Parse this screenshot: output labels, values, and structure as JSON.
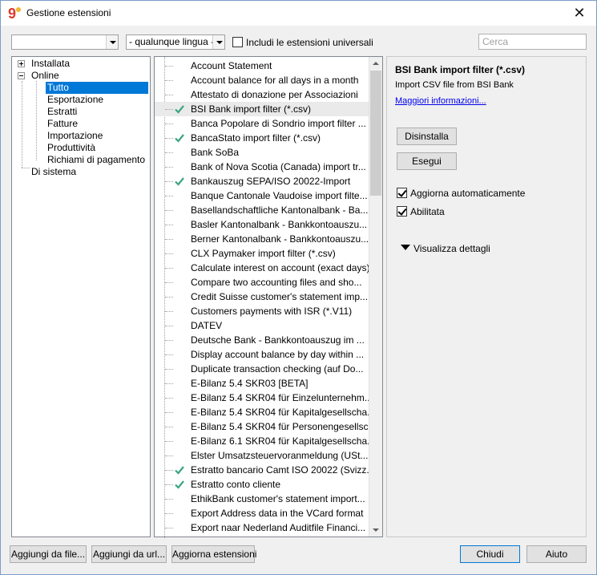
{
  "window": {
    "title": "Gestione estensioni",
    "close_symbol": "✕"
  },
  "toolbar": {
    "category_combo_value": "",
    "language_combo_value": "- qualunque lingua -",
    "universal_checkbox_label": "Includi le estensioni universali",
    "universal_checked": false,
    "search_placeholder": "Cerca"
  },
  "tree": {
    "items": [
      {
        "label": "Installata"
      },
      {
        "label": "Online"
      },
      {
        "label": "Tutto"
      },
      {
        "label": "Esportazione"
      },
      {
        "label": "Estratti"
      },
      {
        "label": "Fatture"
      },
      {
        "label": "Importazione"
      },
      {
        "label": "Produttività"
      },
      {
        "label": "Richiami di pagamento"
      },
      {
        "label": "Di sistema"
      }
    ]
  },
  "extensions": [
    {
      "label": "Account Statement",
      "installed": false
    },
    {
      "label": "Account balance for all days in a month",
      "installed": false
    },
    {
      "label": "Attestato di donazione per Associazioni",
      "installed": false
    },
    {
      "label": "BSI Bank import filter (*.csv)",
      "installed": true
    },
    {
      "label": "Banca Popolare di Sondrio import filter ...",
      "installed": false
    },
    {
      "label": "BancaStato import filter (*.csv)",
      "installed": true
    },
    {
      "label": "Bank SoBa",
      "installed": false
    },
    {
      "label": "Bank of Nova Scotia (Canada) import tr...",
      "installed": false
    },
    {
      "label": "Bankauszug SEPA/ISO 20022-Import",
      "installed": true
    },
    {
      "label": "Banque Cantonale Vaudoise import filte...",
      "installed": false
    },
    {
      "label": "Basellandschaftliche Kantonalbank - Ba...",
      "installed": false
    },
    {
      "label": "Basler Kantonalbank - Bankkontoauszu...",
      "installed": false
    },
    {
      "label": "Berner Kantonalbank - Bankkontoauszu...",
      "installed": false
    },
    {
      "label": "CLX Paymaker import filter (*.csv)",
      "installed": false
    },
    {
      "label": "Calculate interest on account (exact days)",
      "installed": false
    },
    {
      "label": "Compare two accounting files and sho...",
      "installed": false
    },
    {
      "label": "Credit Suisse customer's statement imp...",
      "installed": false
    },
    {
      "label": "Customers payments with ISR (*.V11)",
      "installed": false
    },
    {
      "label": "DATEV",
      "installed": false
    },
    {
      "label": "Deutsche Bank - Bankkontoauszug im ...",
      "installed": false
    },
    {
      "label": "Display account balance by day within ...",
      "installed": false
    },
    {
      "label": "Duplicate transaction checking (auf Do...",
      "installed": false
    },
    {
      "label": "E-Bilanz 5.4 SKR03 [BETA]",
      "installed": false
    },
    {
      "label": "E-Bilanz 5.4 SKR04 für Einzelunternehm...",
      "installed": false
    },
    {
      "label": "E-Bilanz 5.4 SKR04 für Kapitalgesellscha...",
      "installed": false
    },
    {
      "label": "E-Bilanz 5.4 SKR04 für Personengesellsc...",
      "installed": false
    },
    {
      "label": "E-Bilanz 6.1 SKR04 für Kapitalgesellscha...",
      "installed": false
    },
    {
      "label": "Elster Umsatzsteuervoranmeldung (USt...",
      "installed": false
    },
    {
      "label": "Estratto bancario Camt ISO 20022 (Svizz...",
      "installed": true
    },
    {
      "label": "Estratto conto cliente",
      "installed": true
    },
    {
      "label": "EthikBank customer's statement import...",
      "installed": false
    },
    {
      "label": "Export Address data in the VCard format",
      "installed": false
    },
    {
      "label": "Export naar Nederland Auditfile Financi...",
      "installed": false
    }
  ],
  "selected_extension": {
    "title": "BSI Bank import filter (*.csv)",
    "description": "Import CSV file from BSI Bank",
    "more_info_link": "Maggiori informazioni...",
    "uninstall_label": "Disinstalla",
    "run_label": "Esegui",
    "auto_update_label": "Aggiorna automaticamente",
    "auto_update_checked": true,
    "enabled_label": "Abilitata",
    "enabled_checked": true,
    "details_toggle_label": "Visualizza dettagli"
  },
  "footer": {
    "add_from_file": "Aggiungi da file...",
    "add_from_url": "Aggiungi da url...",
    "update_extensions": "Aggiorna estensioni",
    "close": "Chiudi",
    "help": "Aiuto"
  },
  "colors": {
    "selection": "#0078d7",
    "check_green": "#3aa57d",
    "app_icon_red": "#e03a2f"
  }
}
